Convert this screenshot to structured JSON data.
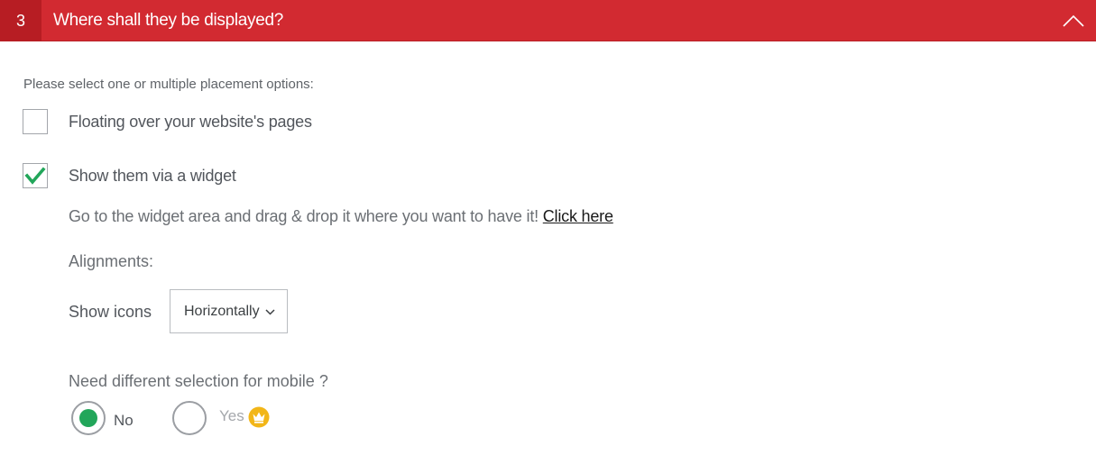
{
  "header": {
    "step_number": "3",
    "title": "Where shall they be displayed?",
    "background": "#d22a31",
    "icon": "chevron-up-icon"
  },
  "instruction": "Please select one or multiple placement options:",
  "options": [
    {
      "label": "Floating over your website's pages",
      "checked": false
    },
    {
      "label": "Show them via a widget",
      "checked": true,
      "check_color": "#22a65a"
    }
  ],
  "widget_hint": {
    "text": "Go to the widget area and drag & drop it where you want to have it!",
    "link": "Click here"
  },
  "alignments_label": "Alignments:",
  "show_icons": {
    "label": "Show icons",
    "selected": "Horizontally",
    "icon": "chevron-down-icon"
  },
  "mobile": {
    "question": "Need different selection for mobile ?",
    "options": [
      {
        "label": "No",
        "selected": true
      },
      {
        "label": "Yes",
        "selected": false,
        "badge_icon": "crown-icon",
        "badge_color": "#f2b618"
      }
    ]
  }
}
